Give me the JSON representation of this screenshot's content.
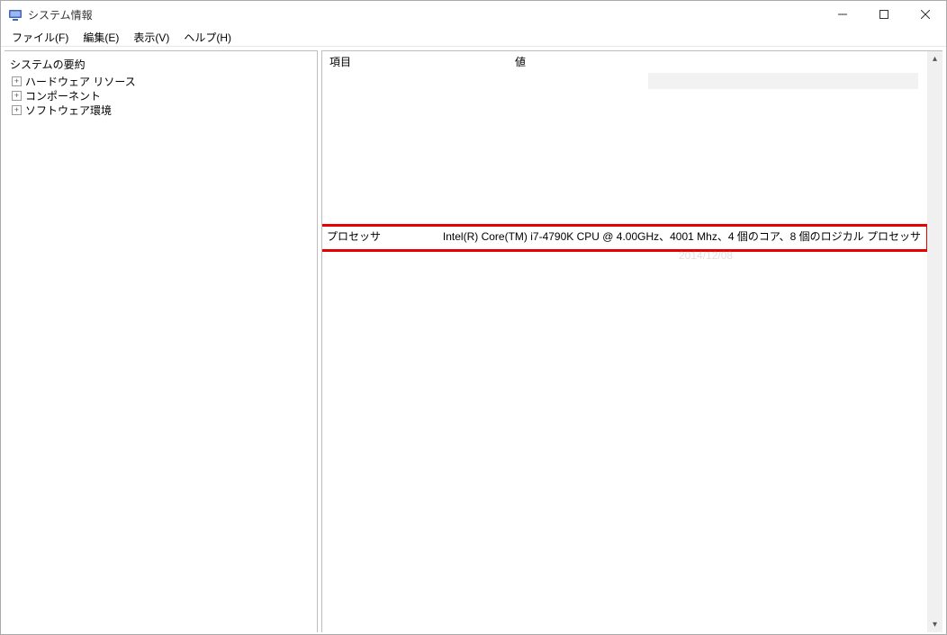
{
  "window": {
    "title": "システム情報"
  },
  "menu": {
    "file": "ファイル(F)",
    "edit": "編集(E)",
    "view": "表示(V)",
    "help": "ヘルプ(H)"
  },
  "tree": {
    "root": "システムの要約",
    "items": [
      "ハードウェア リソース",
      "コンポーネント",
      "ソフトウェア環境"
    ]
  },
  "columns": {
    "item": "項目",
    "value": "値"
  },
  "row": {
    "name": "プロセッサ",
    "value": "Intel(R) Core(TM) i7-4790K CPU @ 4.00GHz、4001 Mhz、4 個のコア、8 個のロジカル プロセッサ"
  },
  "ghost": "2014/12/08"
}
